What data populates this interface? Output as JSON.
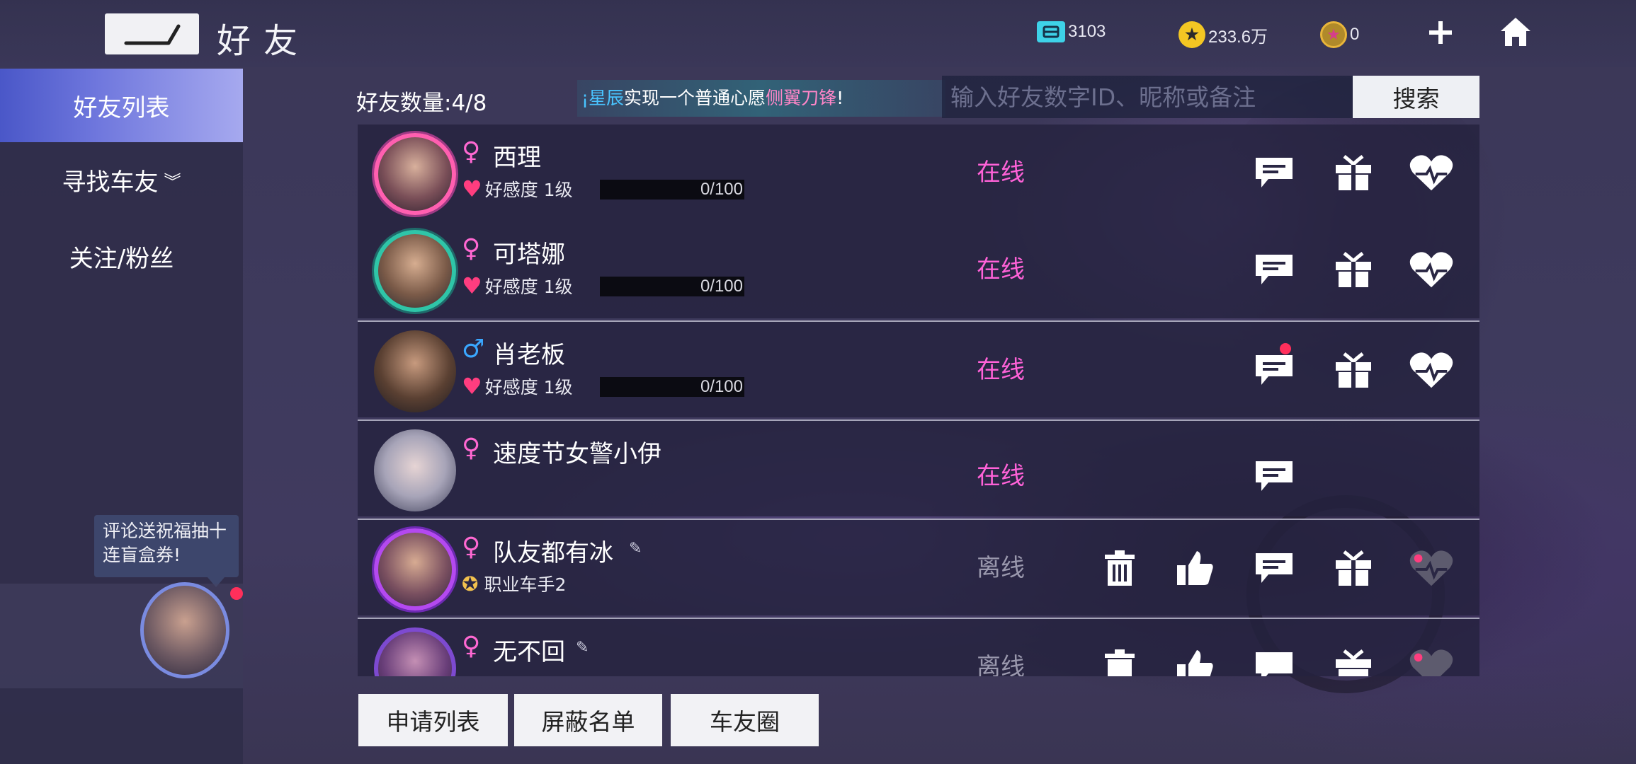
{
  "header": {
    "title": "好友",
    "currencies": [
      {
        "icon": "ticket-icon",
        "value": "3103",
        "color": "#3ed2e8"
      },
      {
        "icon": "gold-coin-icon",
        "value": "233.6万",
        "color": "#f3c623"
      },
      {
        "icon": "star-coin-icon",
        "value": "0",
        "color": "#d63e8c"
      }
    ]
  },
  "sidebar": {
    "items": [
      {
        "label": "好友列表"
      },
      {
        "label": "寻找车友"
      },
      {
        "label": "关注/粉丝"
      }
    ],
    "promo_text": "评论送祝福抽十连盲盒券!"
  },
  "list_header": {
    "friend_count": "好友数量:4/8",
    "marquee_prefix": "¡",
    "marquee_name": "星辰",
    "marquee_mid": "实现一个普通心愿",
    "marquee_item": "侧翼刀锋",
    "marquee_end": "!",
    "search_placeholder": "输入好友数字ID、昵称或备注",
    "search_button": "搜索"
  },
  "friends": [
    {
      "name": "西理",
      "gender": "♀",
      "affinity_label": "好感度 1级",
      "affinity_value": "0/100",
      "status": "在线"
    },
    {
      "name": "可塔娜",
      "gender": "♀",
      "affinity_label": "好感度 1级",
      "affinity_value": "0/100",
      "status": "在线"
    },
    {
      "name": "肖老板",
      "gender": "♂",
      "affinity_label": "好感度 1级",
      "affinity_value": "0/100",
      "status": "在线"
    },
    {
      "name": "速度节女警小伊",
      "gender": "♀",
      "status": "在线"
    },
    {
      "name": "队友都有冰",
      "gender": "♀",
      "rank": "职业车手2",
      "status": "离线"
    },
    {
      "name": "无不回",
      "gender": "♀",
      "status": "离线"
    }
  ],
  "bottom_buttons": {
    "requests": "申请列表",
    "blocklist": "屏蔽名单",
    "moments": "车友圈"
  }
}
